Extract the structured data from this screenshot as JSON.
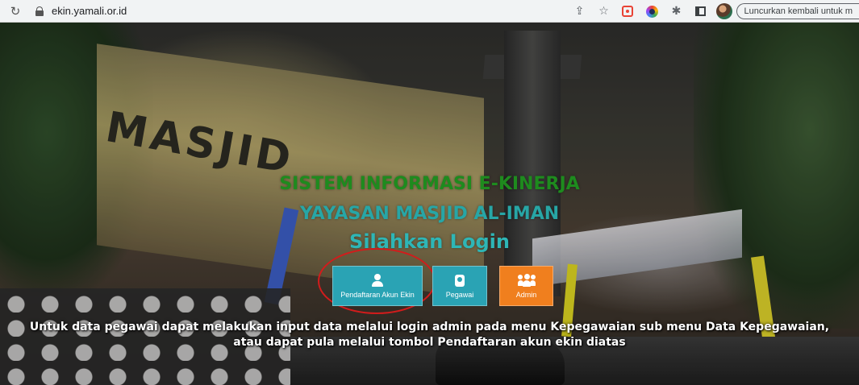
{
  "browser": {
    "url": "ekin.yamali.or.id",
    "relaunch_label": "Luncurkan kembali untuk m"
  },
  "hero": {
    "title_line1": "SISTEM INFORMASI E-KINERJA",
    "title_line2": "YAYASAN MASJID AL-IMAN",
    "title_line3": "Silahkan Login",
    "background_sign": "MASJID"
  },
  "buttons": {
    "daftar_label": "Pendaftaran Akun Ekin",
    "pegawai_label": "Pegawai",
    "admin_label": "Admin"
  },
  "info": {
    "line1": "Untuk data pegawai dapat melakukan input data melalui login admin pada menu Kepegawaian sub menu Data Kepegawaian,",
    "line2": "atau dapat pula melalui tombol Pendaftaran akun ekin diatas"
  },
  "colors": {
    "title_green": "#1e8b1e",
    "title_teal": "#2eb6b6",
    "button_teal": "#2aa3b4",
    "button_orange": "#f07f1e",
    "highlight_red": "#d21c1c"
  },
  "icons": {
    "reload": "reload-icon",
    "lock": "lock-icon",
    "share": "share-icon",
    "bookmark": "star-icon",
    "extensions": "puzzle-icon",
    "user": "user-icon",
    "badge": "id-badge-icon",
    "group": "users-group-icon"
  }
}
